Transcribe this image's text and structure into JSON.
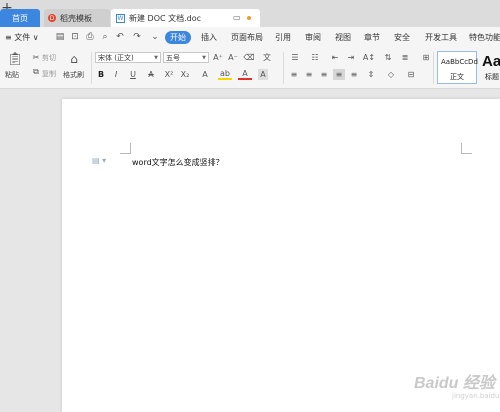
{
  "tabs": {
    "home": "首页",
    "templates": "稻壳模板",
    "document": "新建 DOC 文档.doc",
    "new_tab": "+"
  },
  "menu": {
    "file": "≡ 文件 ∨",
    "items": [
      "开始",
      "插入",
      "页面布局",
      "引用",
      "审阅",
      "视图",
      "章节",
      "安全",
      "开发工具",
      "特色功能"
    ]
  },
  "ribbon": {
    "paste": "粘贴",
    "cut": "剪切",
    "copy": "复制",
    "format_painter": "格式刷",
    "font_name": "宋体 (正文)",
    "font_size": "五号",
    "style_sample": "AaBbCcDd",
    "style_normal": "正文",
    "style_heading_sample": "Aa",
    "style_heading": "标题"
  },
  "document": {
    "text": "word文字怎么变成竖排？"
  },
  "watermark": {
    "main": "Baidu 经验",
    "sub": "jingyan.baidu.com"
  },
  "colors": {
    "accent": "#3d86e0",
    "templates_icon": "#e8412c",
    "unsaved_dot": "#f39a2b"
  }
}
